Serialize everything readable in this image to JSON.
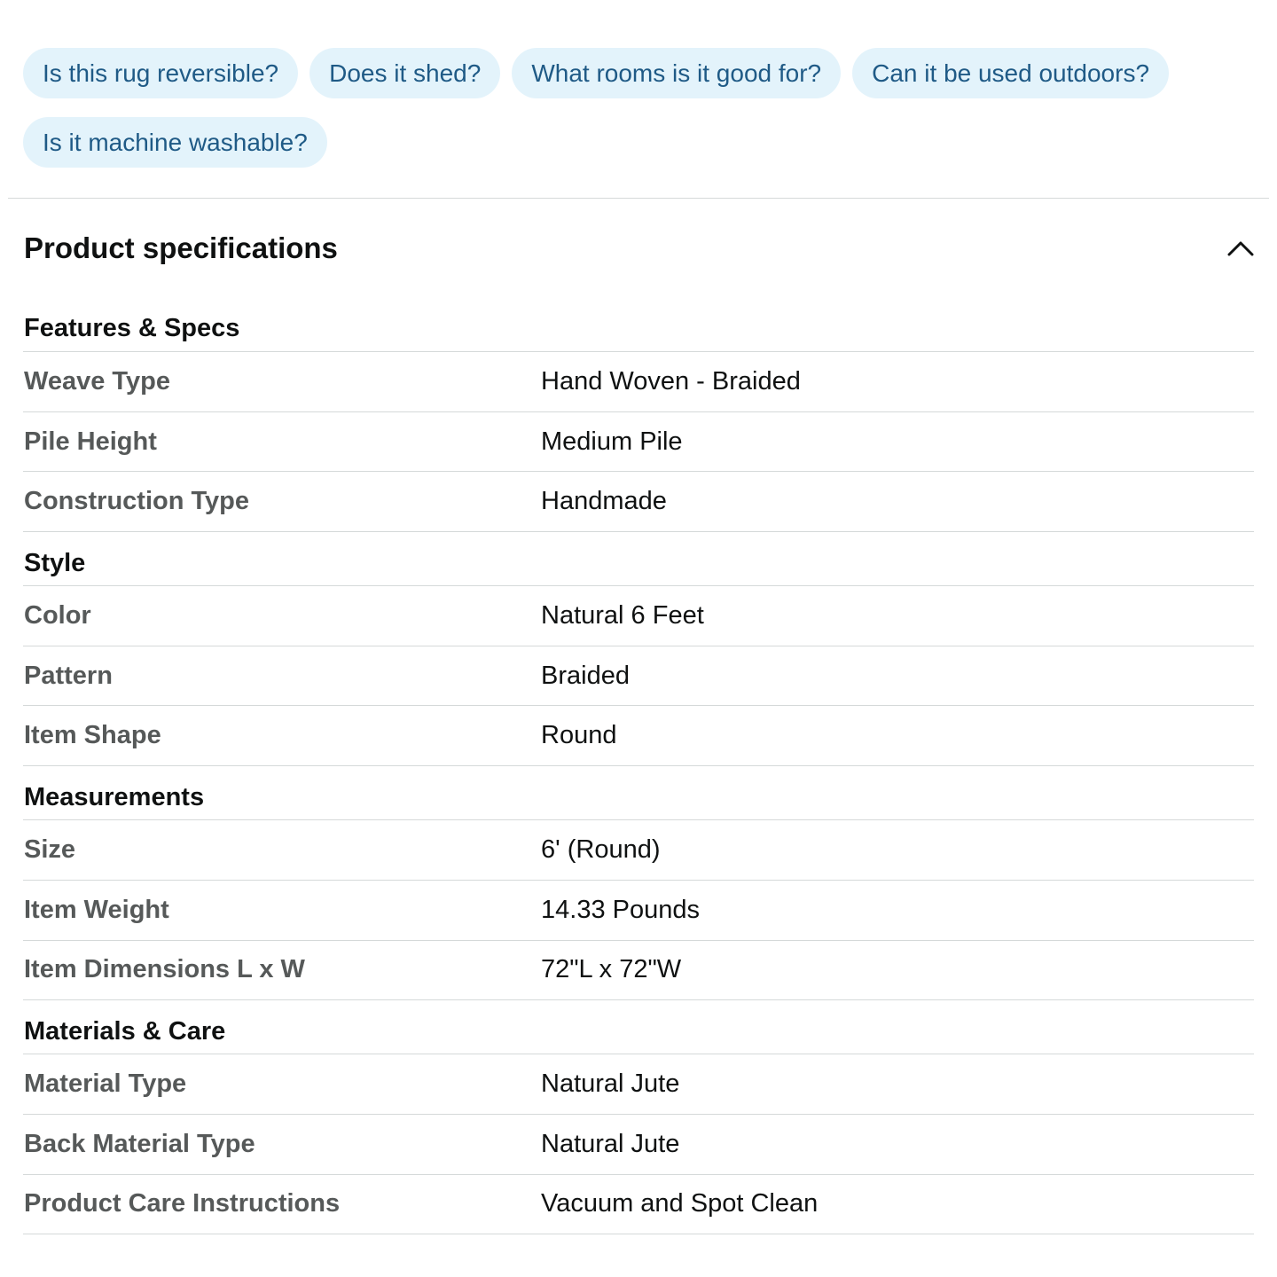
{
  "questions": [
    "Is this rug reversible?",
    "Does it shed?",
    "What rooms is it good for?",
    "Can it be used outdoors?",
    "Is it machine washable?"
  ],
  "section": {
    "title": "Product specifications",
    "toggle_icon": "chevron-up-icon"
  },
  "groups": [
    {
      "title": "Features & Specs",
      "rows": [
        {
          "label": "Weave Type",
          "value": "Hand Woven - Braided"
        },
        {
          "label": "Pile Height",
          "value": "Medium Pile"
        },
        {
          "label": "Construction Type",
          "value": "Handmade"
        }
      ]
    },
    {
      "title": "Style",
      "rows": [
        {
          "label": "Color",
          "value": "Natural 6 Feet"
        },
        {
          "label": "Pattern",
          "value": "Braided"
        },
        {
          "label": "Item Shape",
          "value": "Round"
        }
      ]
    },
    {
      "title": "Measurements",
      "rows": [
        {
          "label": "Size",
          "value": "6' (Round)"
        },
        {
          "label": "Item Weight",
          "value": "14.33 Pounds"
        },
        {
          "label": "Item Dimensions L x W",
          "value": "72\"L x 72\"W"
        }
      ]
    },
    {
      "title": "Materials & Care",
      "rows": [
        {
          "label": "Material Type",
          "value": "Natural Jute"
        },
        {
          "label": "Back Material Type",
          "value": "Natural Jute"
        },
        {
          "label": "Product Care Instructions",
          "value": "Vacuum and Spot Clean"
        }
      ]
    }
  ],
  "colors": {
    "chip_bg": "#e3f3fb",
    "chip_text": "#1f5a86",
    "label_text": "#565959",
    "value_text": "#0f1111",
    "divider": "#d5d9d9"
  }
}
